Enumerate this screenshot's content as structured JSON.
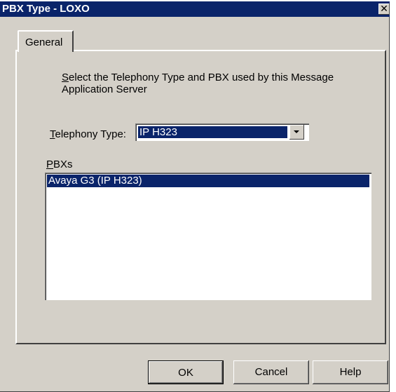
{
  "window": {
    "title": "PBX Type - LOXO",
    "close_glyph": "✕",
    "bg_color": "#d4d0c8",
    "title_color": "#0a246a"
  },
  "tabs": [
    {
      "label": "General",
      "selected": true
    }
  ],
  "instructions": {
    "mnemonic": "S",
    "rest": "elect the Telephony Type and PBX used by this Message Application Server"
  },
  "telephony_type": {
    "label_mnemonic": "T",
    "label_rest": "elephony Type:",
    "value": "IP H323"
  },
  "pbxs": {
    "label_mnemonic": "P",
    "label_rest": "BXs",
    "items": [
      {
        "label": "Avaya G3 (IP H323)",
        "selected": true
      }
    ]
  },
  "buttons": {
    "ok": "OK",
    "cancel": "Cancel",
    "help": "Help"
  },
  "icons": {
    "close": "close-icon",
    "dropdown": "chevron-down-icon"
  }
}
